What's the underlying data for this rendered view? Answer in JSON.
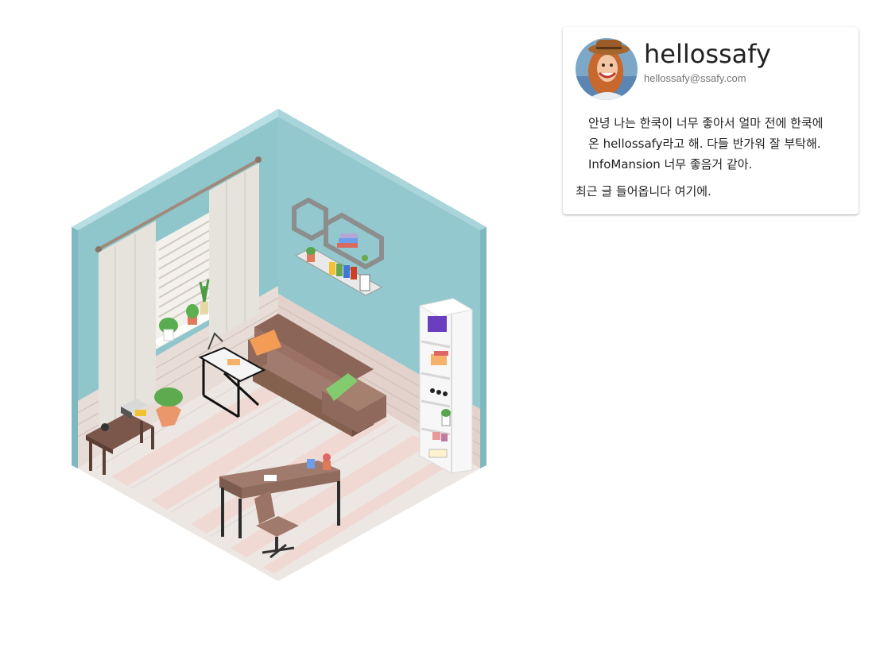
{
  "profile": {
    "username": "hellossafy",
    "email": "hellossafy@ssafy.com",
    "bio": "안녕 나는 한쿡이 너무 좋아서 얼마 전에 한쿡에 온 hellossafy라고 해. 다들 반가워 잘 부탁해. InfoMansion 너무 좋음거 같아.",
    "recent_posts": "최근 글 들어옵니다 여기에."
  },
  "colors": {
    "wall": "#8fc6cc",
    "wall_top": "#b6dde0",
    "floor_light": "#ede7e4",
    "floor_pink": "#f1d9d3",
    "sofa": "#8e6a5e",
    "pillow_orange": "#f0964a",
    "pillow_green": "#86cb72"
  },
  "icons": {
    "avatar": "user-avatar-photo"
  }
}
